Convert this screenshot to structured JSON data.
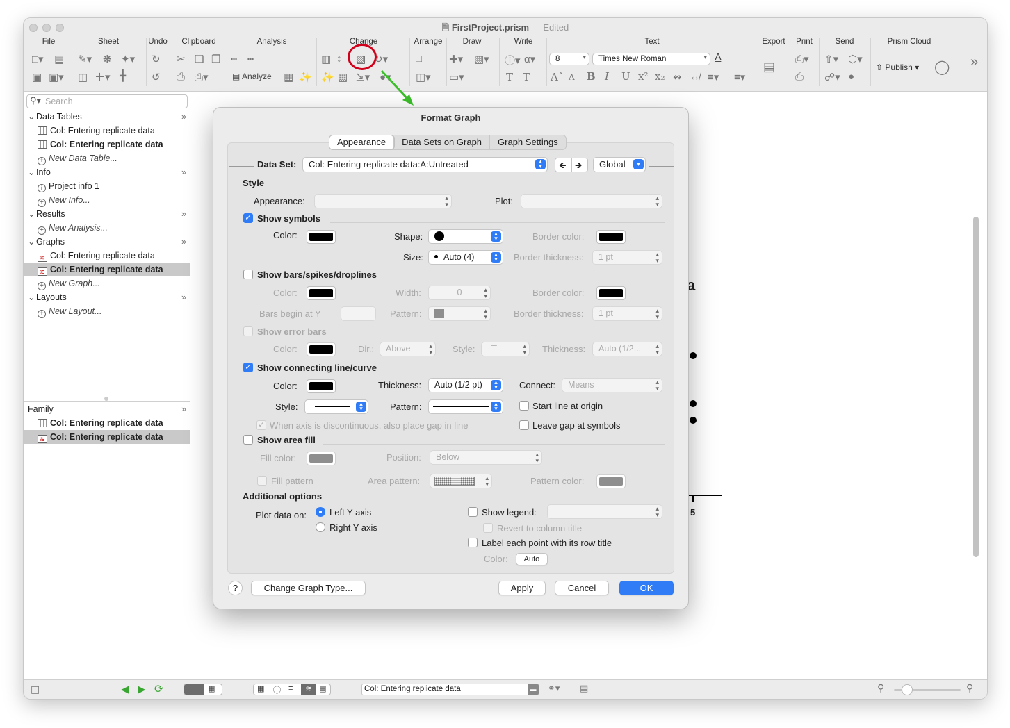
{
  "window": {
    "title": "FirstProject.prism",
    "edited": "— Edited"
  },
  "toolbar": {
    "groups": [
      "File",
      "Sheet",
      "Undo",
      "Clipboard",
      "Analysis",
      "Change",
      "Arrange",
      "Draw",
      "Write",
      "Text",
      "Export",
      "Print",
      "Send",
      "Prism Cloud"
    ],
    "analyze_label": "Analyze",
    "font_size": "8",
    "font_name": "Times New Roman",
    "publish_label": "Publish"
  },
  "sidebar": {
    "search_placeholder": "Search",
    "sections": [
      {
        "title": "Data Tables",
        "items": [
          {
            "label": "Col: Entering replicate data",
            "kind": "table",
            "bold": false,
            "selected": false
          },
          {
            "label": "Col: Entering replicate data",
            "kind": "table",
            "bold": true,
            "selected": false
          },
          {
            "label": "New Data Table...",
            "kind": "new",
            "bold": false,
            "selected": false
          }
        ]
      },
      {
        "title": "Info",
        "items": [
          {
            "label": "Project info 1",
            "kind": "info",
            "bold": false,
            "selected": false
          },
          {
            "label": "New Info...",
            "kind": "new",
            "bold": false,
            "selected": false
          }
        ]
      },
      {
        "title": "Results",
        "items": [
          {
            "label": "New Analysis...",
            "kind": "new",
            "bold": false,
            "selected": false
          }
        ]
      },
      {
        "title": "Graphs",
        "items": [
          {
            "label": "Col: Entering replicate data",
            "kind": "graph",
            "bold": false,
            "selected": false
          },
          {
            "label": "Col: Entering replicate data",
            "kind": "graph",
            "bold": true,
            "selected": true
          },
          {
            "label": "New Graph...",
            "kind": "new",
            "bold": false,
            "selected": false
          }
        ]
      },
      {
        "title": "Layouts",
        "items": [
          {
            "label": "New Layout...",
            "kind": "new",
            "bold": false,
            "selected": false
          }
        ]
      }
    ],
    "family": {
      "title": "Family",
      "items": [
        {
          "label": "Col: Entering replicate data",
          "kind": "table",
          "bold": true,
          "selected": false
        },
        {
          "label": "Col: Entering replicate data",
          "kind": "graph",
          "bold": true,
          "selected": true
        }
      ]
    }
  },
  "statusbar": {
    "sheet_name": "Col: Entering replicate data"
  },
  "canvas": {
    "title_fragment": "a",
    "tick_label": "5"
  },
  "dialog": {
    "title": "Format Graph",
    "tabs": [
      "Appearance",
      "Data Sets on Graph",
      "Graph Settings"
    ],
    "active_tab": 0,
    "data_set_label": "Data Set:",
    "data_set_value": "Col: Entering replicate data:A:Untreated",
    "scope_value": "Global",
    "style": {
      "heading": "Style",
      "appearance_label": "Appearance:",
      "plot_label": "Plot:"
    },
    "symbols": {
      "label": "Show symbols",
      "checked": true,
      "color_label": "Color:",
      "shape_label": "Shape:",
      "border_color_label": "Border color:",
      "size_label": "Size:",
      "size_value": "Auto (4)",
      "border_thickness_label": "Border thickness:",
      "border_thickness_value": "1 pt"
    },
    "bars": {
      "label": "Show bars/spikes/droplines",
      "checked": false,
      "color_label": "Color:",
      "width_label": "Width:",
      "width_value": "0",
      "border_color_label": "Border color:",
      "begin_label": "Bars begin at Y=",
      "pattern_label": "Pattern:",
      "border_thickness_label": "Border thickness:",
      "border_thickness_value": "1 pt"
    },
    "error_bars": {
      "label": "Show error bars",
      "checked": false,
      "color_label": "Color:",
      "dir_label": "Dir.:",
      "dir_value": "Above",
      "style_label": "Style:",
      "thickness_label": "Thickness:",
      "thickness_value": "Auto (1/2..."
    },
    "line": {
      "label": "Show connecting line/curve",
      "checked": true,
      "color_label": "Color:",
      "thickness_label": "Thickness:",
      "thickness_value": "Auto (1/2 pt)",
      "connect_label": "Connect:",
      "connect_value": "Means",
      "style_label": "Style:",
      "pattern_label": "Pattern:",
      "start_origin_label": "Start line at origin",
      "gap_label": "When axis is discontinuous, also place gap in line",
      "leave_gap_label": "Leave gap at symbols"
    },
    "area": {
      "label": "Show area fill",
      "checked": false,
      "fill_color_label": "Fill color:",
      "position_label": "Position:",
      "position_value": "Below",
      "fill_pattern_label": "Fill pattern",
      "area_pattern_label": "Area pattern:",
      "pattern_color_label": "Pattern color:"
    },
    "additional": {
      "heading": "Additional options",
      "plot_on_label": "Plot data on:",
      "left_axis": "Left Y axis",
      "right_axis": "Right Y axis",
      "show_legend_label": "Show legend:",
      "revert_label": "Revert to column title",
      "label_point_label": "Label each point with its row title",
      "color_label": "Color:",
      "color_value": "Auto"
    },
    "buttons": {
      "help": "?",
      "change_type": "Change Graph Type...",
      "apply": "Apply",
      "cancel": "Cancel",
      "ok": "OK"
    }
  },
  "colors": {
    "accent": "#2f7cf6",
    "annotation_circle": "#d0021b",
    "annotation_arrow": "#3cbf2b"
  }
}
